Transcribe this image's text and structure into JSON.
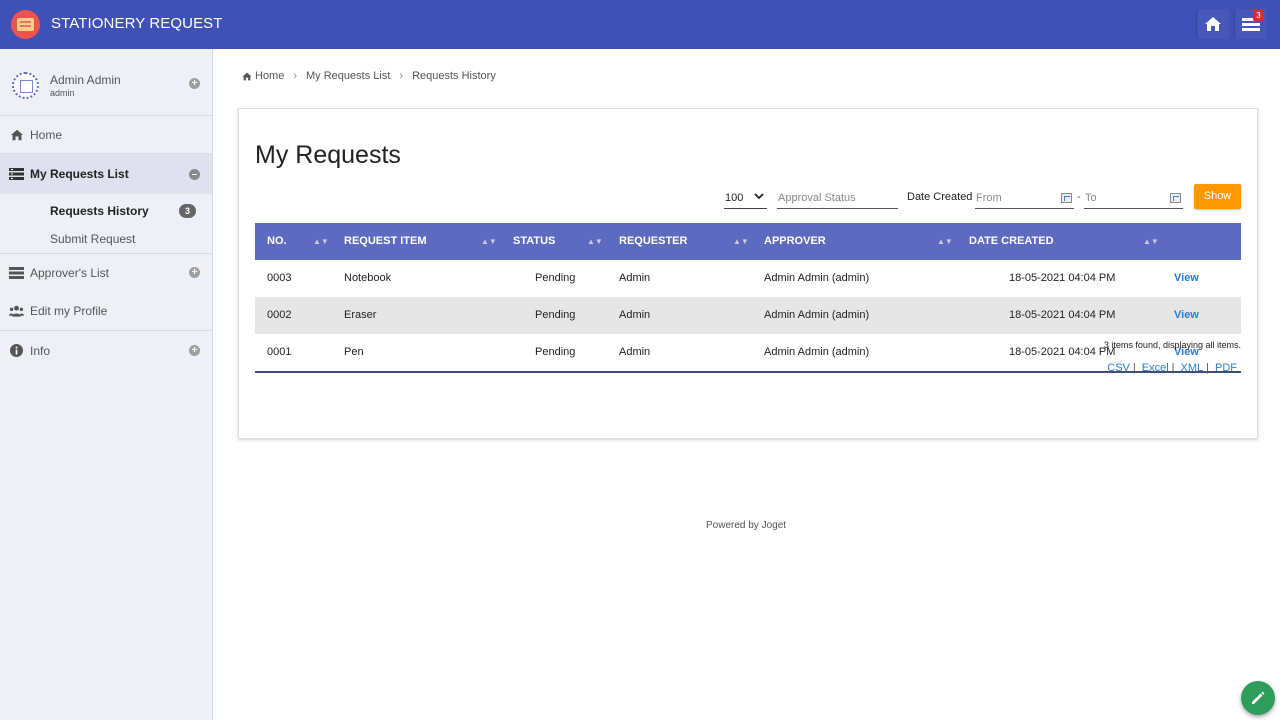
{
  "app": {
    "title": "STATIONERY REQUEST",
    "inbox_count": "3"
  },
  "user": {
    "name": "Admin Admin",
    "role": "admin"
  },
  "sidebar": {
    "home": "Home",
    "my_requests": "My Requests List",
    "sub_items": [
      "Requests History",
      "Submit Request"
    ],
    "history_count": "3",
    "approvers": "Approver's List",
    "edit_profile": "Edit my Profile",
    "info": "Info"
  },
  "breadcrumb": [
    "Home",
    "My Requests List",
    "Requests History"
  ],
  "page": {
    "title": "My Requests"
  },
  "filters": {
    "page_size": "100",
    "status_placeholder": "Approval Status",
    "date_label": "Date Created",
    "from_placeholder": "From",
    "dash": "-",
    "to_placeholder": "To",
    "show_label": "Show"
  },
  "table": {
    "columns": [
      "NO.",
      "REQUEST ITEM",
      "STATUS",
      "REQUESTER",
      "APPROVER",
      "DATE CREATED"
    ],
    "rows": [
      {
        "no": "0003",
        "item": "Notebook",
        "status": "Pending",
        "requester": "Admin",
        "approver": "Admin Admin (admin)",
        "date": "18-05-2021 04:04 PM",
        "action": "View"
      },
      {
        "no": "0002",
        "item": "Eraser",
        "status": "Pending",
        "requester": "Admin",
        "approver": "Admin Admin (admin)",
        "date": "18-05-2021 04:04 PM",
        "action": "View"
      },
      {
        "no": "0001",
        "item": "Pen",
        "status": "Pending",
        "requester": "Admin",
        "approver": "Admin Admin (admin)",
        "date": "18-05-2021 04:04 PM",
        "action": "View"
      }
    ],
    "summary": "3 items found, displaying all items."
  },
  "exports": [
    "CSV",
    "Excel",
    "XML",
    "PDF"
  ],
  "footer": {
    "powered": "Powered by Joget"
  },
  "colors": {
    "primary": "#3f51b5",
    "table_header": "#5c6bc0",
    "accent": "#ff9800",
    "link": "#2b7bd6",
    "fab": "#2e9d5b"
  },
  "icons": [
    "app-logo-icon",
    "home-icon",
    "inbox-icon",
    "list-icon",
    "users-icon",
    "info-icon",
    "calendar-icon",
    "sort-icon",
    "pencil-icon"
  ]
}
